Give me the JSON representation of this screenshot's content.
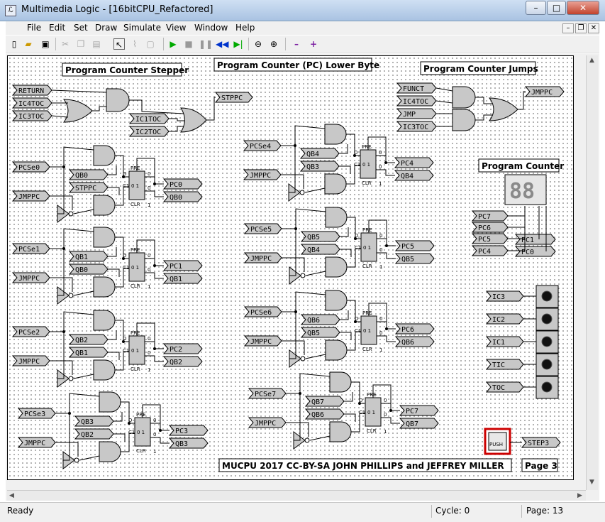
{
  "window": {
    "title": "Multimedia Logic - [16bitCPU_Refactored]",
    "minimize": "–",
    "maximize": "□",
    "close": "✕"
  },
  "menu": [
    "File",
    "Edit",
    "Set",
    "Draw",
    "Simulate",
    "View",
    "Window",
    "Help"
  ],
  "toolbar_icons": [
    "new-icon",
    "open-icon",
    "save-icon",
    "cut-icon",
    "copy-icon",
    "paste-icon",
    "select-icon",
    "wire-icon",
    "delete-icon",
    "run-icon",
    "stop-icon",
    "pause-icon",
    "step-back-icon",
    "step-icon",
    "zoom-out-icon",
    "zoom-in-icon",
    "minus-icon",
    "plus-icon"
  ],
  "titles": {
    "stepper": "Program Counter Stepper",
    "pc_lower": "Program Counter (PC) Lower Byte",
    "jumps": "Program Counter Jumps",
    "counter": "Program Counter",
    "footer": "MUCPU 2017 CC-BY-SA JOHN PHILLIPS and JEFFREY MILLER",
    "page": "Page 3"
  },
  "stepper_inputs": [
    "RETURN",
    "IC4TOC",
    "IC3TOC",
    "IC1TOC",
    "IC2TOC"
  ],
  "stepper_output": "STPPC",
  "jump_inputs": [
    "FUNCT",
    "IC4TOC",
    "JMP",
    "IC3TOC"
  ],
  "jump_output": "JMPPC",
  "bits": [
    {
      "sel": "PCSe0",
      "jmp": "JMPPC",
      "in1": "QB0",
      "in2": "STPPC",
      "out1": "PC0",
      "out2": "QB0"
    },
    {
      "sel": "PCSe1",
      "jmp": "JMPPC",
      "in1": "QB1",
      "in2": "QB0",
      "out1": "PC1",
      "out2": "QB1"
    },
    {
      "sel": "PCSe2",
      "jmp": "JMPPC",
      "in1": "QB2",
      "in2": "QB1",
      "out1": "PC2",
      "out2": "QB2"
    },
    {
      "sel": "PCSe3",
      "jmp": "JMPPC",
      "in1": "QB3",
      "in2": "QB2",
      "out1": "PC3",
      "out2": "QB3"
    },
    {
      "sel": "PCSe4",
      "jmp": "JMPPC",
      "in1": "QB4",
      "in2": "QB3",
      "out1": "PC4",
      "out2": "QB4"
    },
    {
      "sel": "PCSe5",
      "jmp": "JMPPC",
      "in1": "QB5",
      "in2": "QB4",
      "out1": "PC5",
      "out2": "QB5"
    },
    {
      "sel": "PCSe6",
      "jmp": "JMPPC",
      "in1": "QB6",
      "in2": "QB5",
      "out1": "PC6",
      "out2": "QB6"
    },
    {
      "sel": "PCSe7",
      "jmp": "JMPPC",
      "in1": "QB7",
      "in2": "QB6",
      "out1": "PC7",
      "out2": "QB7"
    }
  ],
  "flipflop": {
    "pre": "PRE",
    "clr": "CLR",
    "clk": "C1",
    "dlabel": "D",
    "cell": "0 1",
    "q": "0",
    "one": "1"
  },
  "display_inputs": [
    "PC7",
    "PC6",
    "PC5",
    "PC4",
    "PC1",
    "PC0"
  ],
  "display_digits": "88",
  "leds": [
    "IC3",
    "IC2",
    "IC1",
    "TIC",
    "TOC"
  ],
  "pushbutton": "PUSH",
  "step_output": "STEP3",
  "status": {
    "ready": "Ready",
    "cycle": "Cycle: 0",
    "page": "Page: 13"
  }
}
